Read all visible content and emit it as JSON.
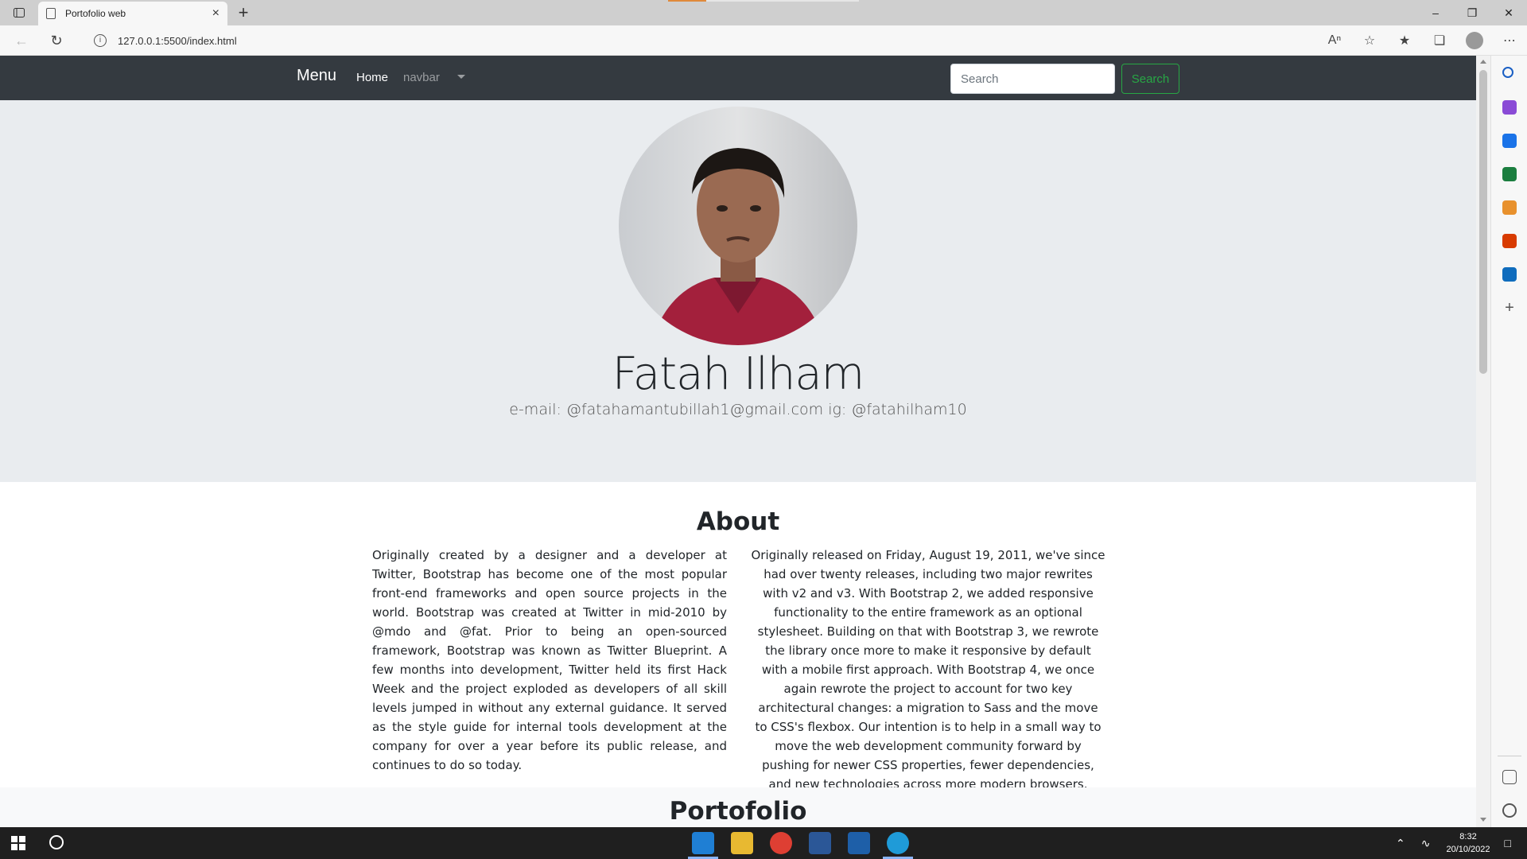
{
  "browser": {
    "tab_title": "Portofolio web",
    "url": "127.0.0.1:5500/index.html",
    "newtab_glyph": "+",
    "close_glyph": "×"
  },
  "navbar": {
    "brand": "Menu",
    "home": "Home",
    "navbar_link": "navbar",
    "search_placeholder": "Search",
    "search_button": "Search",
    "bg_color": "#343a40",
    "accent_color": "#28a745"
  },
  "profile": {
    "name": "Fatah Ilham",
    "contact": "e-mail: @fatahamantubillah1@gmail.com ig: @fatahilham10"
  },
  "about": {
    "title": "About",
    "left_text": "Originally created by a designer and a developer at Twitter, Bootstrap has become one of the most popular front-end frameworks and open source projects in the world. Bootstrap was created at Twitter in mid-2010 by @mdo and @fat. Prior to being an open-sourced framework, Bootstrap was known as Twitter Blueprint. A few months into development, Twitter held its first Hack Week and the project exploded as developers of all skill levels jumped in without any external guidance. It served as the style guide for internal tools development at the company for over a year before its public release, and continues to do so today.",
    "right_text": "Originally released on Friday, August 19, 2011, we've since had over twenty releases, including two major rewrites with v2 and v3. With Bootstrap 2, we added responsive functionality to the entire framework as an optional stylesheet. Building on that with Bootstrap 3, we rewrote the library once more to make it responsive by default with a mobile first approach. With Bootstrap 4, we once again rewrote the project to account for two key architectural changes: a migration to Sass and the move to CSS's flexbox. Our intention is to help in a small way to move the web development community forward by pushing for newer CSS properties, fewer dependencies, and new technologies across more modern browsers."
  },
  "portfolio": {
    "title": "Portofolio"
  },
  "taskbar": {
    "time": "8:32",
    "date": "20/10/2022"
  }
}
